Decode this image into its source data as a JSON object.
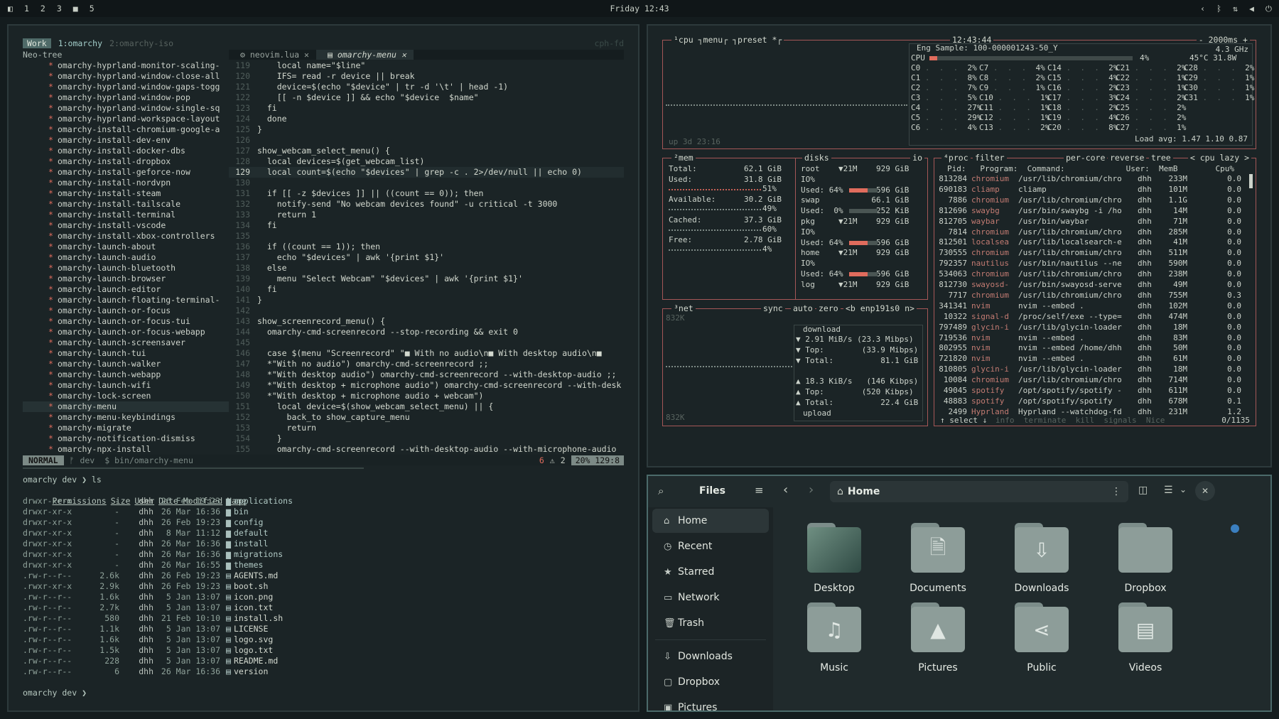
{
  "topbar": {
    "workspaces": [
      "1",
      "2",
      "3",
      "4",
      "5"
    ],
    "clock": "Friday 12:43"
  },
  "nvim": {
    "tag": "Work",
    "tab_active": "1:omarchy",
    "tab_inactive": "2:omarchy-iso",
    "tab_right": "cph-fd",
    "tree_title": "Neo-tree",
    "tree_items": [
      "omarchy-hyprland-monitor-scaling-",
      "omarchy-hyprland-window-close-all",
      "omarchy-hyprland-window-gaps-togg",
      "omarchy-hyprland-window-pop",
      "omarchy-hyprland-window-single-sq",
      "omarchy-hyprland-workspace-layout",
      "omarchy-install-chromium-google-a",
      "omarchy-install-dev-env",
      "omarchy-install-docker-dbs",
      "omarchy-install-dropbox",
      "omarchy-install-geforce-now",
      "omarchy-install-nordvpn",
      "omarchy-install-steam",
      "omarchy-install-tailscale",
      "omarchy-install-terminal",
      "omarchy-install-vscode",
      "omarchy-install-xbox-controllers",
      "omarchy-launch-about",
      "omarchy-launch-audio",
      "omarchy-launch-bluetooth",
      "omarchy-launch-browser",
      "omarchy-launch-editor",
      "omarchy-launch-floating-terminal-",
      "omarchy-launch-or-focus",
      "omarchy-launch-or-focus-tui",
      "omarchy-launch-or-focus-webapp",
      "omarchy-launch-screensaver",
      "omarchy-launch-tui",
      "omarchy-launch-walker",
      "omarchy-launch-webapp",
      "omarchy-launch-wifi",
      "omarchy-lock-screen",
      "omarchy-menu",
      "omarchy-menu-keybindings",
      "omarchy-migrate",
      "omarchy-notification-dismiss",
      "omarchy-npx-install"
    ],
    "buffer1": "neovim.lua",
    "buffer2": "omarchy-menu",
    "code": [
      {
        "n": "119",
        "t": "    local name=\"$line\""
      },
      {
        "n": "120",
        "t": "    IFS= read -r device || break"
      },
      {
        "n": "121",
        "t": "    device=$(echo \"$device\" | tr -d '\\t' | head -1)"
      },
      {
        "n": "122",
        "t": "    [[ -n $device ]] && echo \"$device  $name\""
      },
      {
        "n": "123",
        "t": "  fi"
      },
      {
        "n": "124",
        "t": "  done"
      },
      {
        "n": "125",
        "t": "}"
      },
      {
        "n": "126",
        "t": ""
      },
      {
        "n": "127",
        "t": "show_webcam_select_menu() {"
      },
      {
        "n": "128",
        "t": "  local devices=$(get_webcam_list)"
      },
      {
        "n": "129",
        "t": "  local count=$(echo \"$devices\" | grep -c . 2>/dev/null || echo 0)"
      },
      {
        "n": "130",
        "t": ""
      },
      {
        "n": "131",
        "t": "  if [[ -z $devices ]] || ((count == 0)); then"
      },
      {
        "n": "132",
        "t": "    notify-send \"No webcam devices found\" -u critical -t 3000"
      },
      {
        "n": "133",
        "t": "    return 1"
      },
      {
        "n": "134",
        "t": "  fi"
      },
      {
        "n": "135",
        "t": ""
      },
      {
        "n": "136",
        "t": "  if ((count == 1)); then"
      },
      {
        "n": "137",
        "t": "    echo \"$devices\" | awk '{print $1}'"
      },
      {
        "n": "138",
        "t": "  else"
      },
      {
        "n": "139",
        "t": "    menu \"Select Webcam\" \"$devices\" | awk '{print $1}'"
      },
      {
        "n": "140",
        "t": "  fi"
      },
      {
        "n": "141",
        "t": "}"
      },
      {
        "n": "142",
        "t": ""
      },
      {
        "n": "143",
        "t": "show_screenrecord_menu() {"
      },
      {
        "n": "144",
        "t": "  omarchy-cmd-screenrecord --stop-recording && exit 0"
      },
      {
        "n": "145",
        "t": ""
      },
      {
        "n": "146",
        "t": "  case $(menu \"Screenrecord\" \"■ With no audio\\n■ With desktop audio\\n■"
      },
      {
        "n": "147",
        "t": "  *\"With no audio\") omarchy-cmd-screenrecord ;;"
      },
      {
        "n": "148",
        "t": "  *\"With desktop audio\") omarchy-cmd-screenrecord --with-desktop-audio ;;"
      },
      {
        "n": "149",
        "t": "  *\"With desktop + microphone audio\") omarchy-cmd-screenrecord --with-desk"
      },
      {
        "n": "150",
        "t": "  *\"With desktop + microphone audio + webcam\")"
      },
      {
        "n": "151",
        "t": "    local device=$(show_webcam_select_menu) || {"
      },
      {
        "n": "152",
        "t": "      back_to show_capture_menu"
      },
      {
        "n": "153",
        "t": "      return"
      },
      {
        "n": "154",
        "t": "    }"
      },
      {
        "n": "155",
        "t": "    omarchy-cmd-screenrecord --with-desktop-audio --with-microphone-audio"
      }
    ],
    "status": {
      "mode": "NORMAL",
      "branch": "dev",
      "file": "bin/omarchy-menu",
      "diag": "6",
      "warn": "2",
      "pos": "20% 129:8"
    },
    "terminal": {
      "prompt1": "omarchy dev ❯ ls",
      "headers": [
        "Permissions",
        "Size",
        "User",
        "Date Modified",
        "Name"
      ],
      "rows": [
        {
          "perm": "drwxr-xr-x",
          "size": "-",
          "user": "dhh",
          "date": "26 Feb 19:23",
          "name": "applications",
          "dir": true
        },
        {
          "perm": "drwxr-xr-x",
          "size": "-",
          "user": "dhh",
          "date": "26 Mar 16:36",
          "name": "bin",
          "dir": true
        },
        {
          "perm": "drwxr-xr-x",
          "size": "-",
          "user": "dhh",
          "date": "26 Feb 19:23",
          "name": "config",
          "dir": true
        },
        {
          "perm": "drwxr-xr-x",
          "size": "-",
          "user": "dhh",
          "date": "8 Mar 11:12",
          "name": "default",
          "dir": true
        },
        {
          "perm": "drwxr-xr-x",
          "size": "-",
          "user": "dhh",
          "date": "26 Mar 16:36",
          "name": "install",
          "dir": true
        },
        {
          "perm": "drwxr-xr-x",
          "size": "-",
          "user": "dhh",
          "date": "26 Mar 16:36",
          "name": "migrations",
          "dir": true
        },
        {
          "perm": "drwxr-xr-x",
          "size": "-",
          "user": "dhh",
          "date": "26 Mar 16:55",
          "name": "themes",
          "dir": true
        },
        {
          "perm": ".rw-r--r--",
          "size": "2.6k",
          "user": "dhh",
          "date": "26 Feb 19:23",
          "name": "AGENTS.md",
          "dir": false
        },
        {
          "perm": ".rwxr-xr-x",
          "size": "2.9k",
          "user": "dhh",
          "date": "26 Feb 19:23",
          "name": "boot.sh",
          "dir": false
        },
        {
          "perm": ".rw-r--r--",
          "size": "1.6k",
          "user": "dhh",
          "date": "5 Jan 13:07",
          "name": "icon.png",
          "dir": false
        },
        {
          "perm": ".rw-r--r--",
          "size": "2.7k",
          "user": "dhh",
          "date": "5 Jan 13:07",
          "name": "icon.txt",
          "dir": false
        },
        {
          "perm": ".rw-r--r--",
          "size": "580",
          "user": "dhh",
          "date": "21 Feb 10:10",
          "name": "install.sh",
          "dir": false
        },
        {
          "perm": ".rw-r--r--",
          "size": "1.1k",
          "user": "dhh",
          "date": "5 Jan 13:07",
          "name": "LICENSE",
          "dir": false
        },
        {
          "perm": ".rw-r--r--",
          "size": "1.6k",
          "user": "dhh",
          "date": "5 Jan 13:07",
          "name": "logo.svg",
          "dir": false
        },
        {
          "perm": ".rw-r--r--",
          "size": "1.5k",
          "user": "dhh",
          "date": "5 Jan 13:07",
          "name": "logo.txt",
          "dir": false
        },
        {
          "perm": ".rw-r--r--",
          "size": "228",
          "user": "dhh",
          "date": "5 Jan 13:07",
          "name": "README.md",
          "dir": false
        },
        {
          "perm": ".rw-r--r--",
          "size": "6",
          "user": "dhh",
          "date": "26 Mar 16:36",
          "name": "version",
          "dir": false
        }
      ],
      "prompt2": "omarchy dev ❯"
    }
  },
  "btop": {
    "cpu": {
      "title": "¹cpu ┐menu┌ ┐preset *┌",
      "time": "12:43:44",
      "rate": "- 2000ms +",
      "freq": "4.3 GHz",
      "eng": "Eng Sample: 100-000001243-50_Y",
      "total_label": "CPU",
      "total_pct": "4%",
      "temp": "45°C 31.8W",
      "uptime": "up 3d 23:16",
      "load": "Load avg: 1.47 1.10 0.87",
      "cores": [
        [
          "C0",
          "2%"
        ],
        [
          "C7",
          "4%"
        ],
        [
          "C14",
          "2%"
        ],
        [
          "C21",
          "2%"
        ],
        [
          "C28",
          "2%"
        ],
        [
          "C1",
          "8%"
        ],
        [
          "C8",
          "2%"
        ],
        [
          "C15",
          "4%"
        ],
        [
          "C22",
          "1%"
        ],
        [
          "C29",
          "1%"
        ],
        [
          "C2",
          "7%"
        ],
        [
          "C9",
          "1%"
        ],
        [
          "C16",
          "2%"
        ],
        [
          "C23",
          "1%"
        ],
        [
          "C30",
          "1%"
        ],
        [
          "C3",
          "5%"
        ],
        [
          "C10",
          "1%"
        ],
        [
          "C17",
          "3%"
        ],
        [
          "C24",
          "2%"
        ],
        [
          "C31",
          "1%"
        ],
        [
          "C4",
          "27%"
        ],
        [
          "C11",
          "1%"
        ],
        [
          "C18",
          "2%"
        ],
        [
          "C25",
          "2%"
        ],
        [
          "C5",
          "29%"
        ],
        [
          "C12",
          "1%"
        ],
        [
          "C19",
          "4%"
        ],
        [
          "C26",
          "2%"
        ],
        [
          "C6",
          "4%"
        ],
        [
          "C13",
          "2%"
        ],
        [
          "C20",
          "8%"
        ],
        [
          "C27",
          "1%"
        ]
      ]
    },
    "mem": {
      "title": "²mem",
      "total": "Total:          62.1 GiB",
      "used": "Used:           31.8 GiB",
      "used_pct": "51%",
      "available": "Available:      30.2 GiB",
      "available_pct": "49%",
      "cached": "Cached:         37.3 GiB",
      "cached_pct": "60%",
      "free": "Free:           2.78 GiB",
      "free_pct": "4%"
    },
    "disks": {
      "title": "disks",
      "io": "io",
      "lines": [
        "root    ▼21M    929 GiB",
        "IO%",
        "Used: 64%       596 GiB",
        "swap           66.1 GiB",
        "Used:  0%       252 KiB",
        "pkg     ▼21M    929 GiB",
        "IO%",
        "Used: 64%       596 GiB",
        "home    ▼21M    929 GiB",
        "IO%",
        "Used: 64%       596 GiB",
        "log     ▼21M    929 GiB"
      ],
      "used_pcts": [
        0.64,
        0.0,
        0.64,
        0.64
      ]
    },
    "net": {
      "title": "³net",
      "sync": "sync",
      "auto": "auto",
      "zero": "zero",
      "iface": "<b enp191s0 n>",
      "scale_top": "832K",
      "scale_bottom": "832K",
      "download": "download",
      "dl_rate": "▼ 2.91 MiB/s (23.3 Mibps)",
      "dl_top": "▼ Top:        (33.9 Mibps)",
      "dl_total": "▼ Total:          81.1 GiB",
      "ul_rate": "▲ 18.3 KiB/s   (146 Kibps)",
      "ul_top": "▲ Top:        (520 Kibps)",
      "ul_total": "▲ Total:          22.4 GiB",
      "upload": "upload"
    },
    "proc": {
      "title": "⁴proc",
      "filter": "filter",
      "percore": "per-core",
      "reverse": "reverse",
      "tree": "tree",
      "sort": "< cpu lazy >",
      "header": "Pid:   Program:  Command:             User:  MemB        Cpu%",
      "rows": [
        [
          "813284",
          "chromium",
          "/usr/lib/chromium/chro",
          "dhh",
          "233M",
          "0.0"
        ],
        [
          "690183",
          "cliamp",
          "cliamp",
          "dhh",
          "101M",
          "0.0"
        ],
        [
          "7886",
          "chromium",
          "/usr/lib/chromium/chro",
          "dhh",
          "1.1G",
          "0.0"
        ],
        [
          "812696",
          "swaybg",
          "/usr/bin/swaybg -i /ho",
          "dhh",
          "14M",
          "0.0"
        ],
        [
          "812705",
          "waybar",
          "/usr/bin/waybar",
          "dhh",
          "71M",
          "0.0"
        ],
        [
          "7814",
          "chromium",
          "/usr/lib/chromium/chro",
          "dhh",
          "285M",
          "0.0"
        ],
        [
          "812501",
          "localsea",
          "/usr/lib/localsearch-e",
          "dhh",
          "41M",
          "0.0"
        ],
        [
          "730555",
          "chromium",
          "/usr/lib/chromium/chro",
          "dhh",
          "511M",
          "0.0"
        ],
        [
          "792357",
          "nautilus",
          "/usr/bin/nautilus --ne",
          "dhh",
          "590M",
          "0.0"
        ],
        [
          "534063",
          "chromium",
          "/usr/lib/chromium/chro",
          "dhh",
          "238M",
          "0.0"
        ],
        [
          "812730",
          "swayosd-",
          "/usr/bin/swayosd-serve",
          "dhh",
          "49M",
          "0.0"
        ],
        [
          "7717",
          "chromium",
          "/usr/lib/chromium/chro",
          "dhh",
          "755M",
          "0.3"
        ],
        [
          "341341",
          "nvim",
          "nvim --embed .",
          "dhh",
          "102M",
          "0.0"
        ],
        [
          "10322",
          "signal-d",
          "/proc/self/exe --type=",
          "dhh",
          "474M",
          "0.0"
        ],
        [
          "797489",
          "glycin-i",
          "/usr/lib/glycin-loader",
          "dhh",
          "18M",
          "0.0"
        ],
        [
          "719536",
          "nvim",
          "nvim --embed .",
          "dhh",
          "83M",
          "0.0"
        ],
        [
          "802955",
          "nvim",
          "nvim --embed /home/dhh",
          "dhh",
          "50M",
          "0.0"
        ],
        [
          "721820",
          "nvim",
          "nvim --embed .",
          "dhh",
          "61M",
          "0.0"
        ],
        [
          "810805",
          "glycin-i",
          "/usr/lib/glycin-loader",
          "dhh",
          "18M",
          "0.0"
        ],
        [
          "10084",
          "chromium",
          "/usr/lib/chromium/chro",
          "dhh",
          "714M",
          "0.0"
        ],
        [
          "49045",
          "spotify",
          "/opt/spotify/spotify -",
          "dhh",
          "611M",
          "0.0"
        ],
        [
          "48883",
          "spotify",
          "/opt/spotify/spotify",
          "dhh",
          "678M",
          "0.1"
        ],
        [
          "2499",
          "Hyprland",
          "Hyprland --watchdog-fd",
          "dhh",
          "231M",
          "1.2"
        ]
      ],
      "footer_left": "↑ select ↓",
      "footer_mid": "info  terminate  kill  signals  Nice",
      "footer_count": "0/1135"
    }
  },
  "files": {
    "title": "Files",
    "location": "Home",
    "sidebar": [
      {
        "label": "Home",
        "icon": "⌂",
        "sel": true
      },
      {
        "label": "Recent",
        "icon": "◷"
      },
      {
        "label": "Starred",
        "icon": "★"
      },
      {
        "label": "Network",
        "icon": "▭"
      },
      {
        "label": "Trash",
        "icon": "🗑"
      }
    ],
    "sidebar2": [
      {
        "label": "Downloads",
        "icon": "⇩"
      },
      {
        "label": "Dropbox",
        "icon": "▢"
      },
      {
        "label": "Pictures",
        "icon": "▣"
      }
    ],
    "folders": [
      {
        "label": "Desktop",
        "glyph": ""
      },
      {
        "label": "Documents",
        "glyph": "🗎"
      },
      {
        "label": "Downloads",
        "glyph": "⇩"
      },
      {
        "label": "Dropbox",
        "glyph": ""
      },
      {
        "label": "Music",
        "glyph": "♫"
      },
      {
        "label": "Pictures",
        "glyph": "▲"
      },
      {
        "label": "Public",
        "glyph": "⋖"
      },
      {
        "label": "Videos",
        "glyph": "▤"
      }
    ]
  }
}
